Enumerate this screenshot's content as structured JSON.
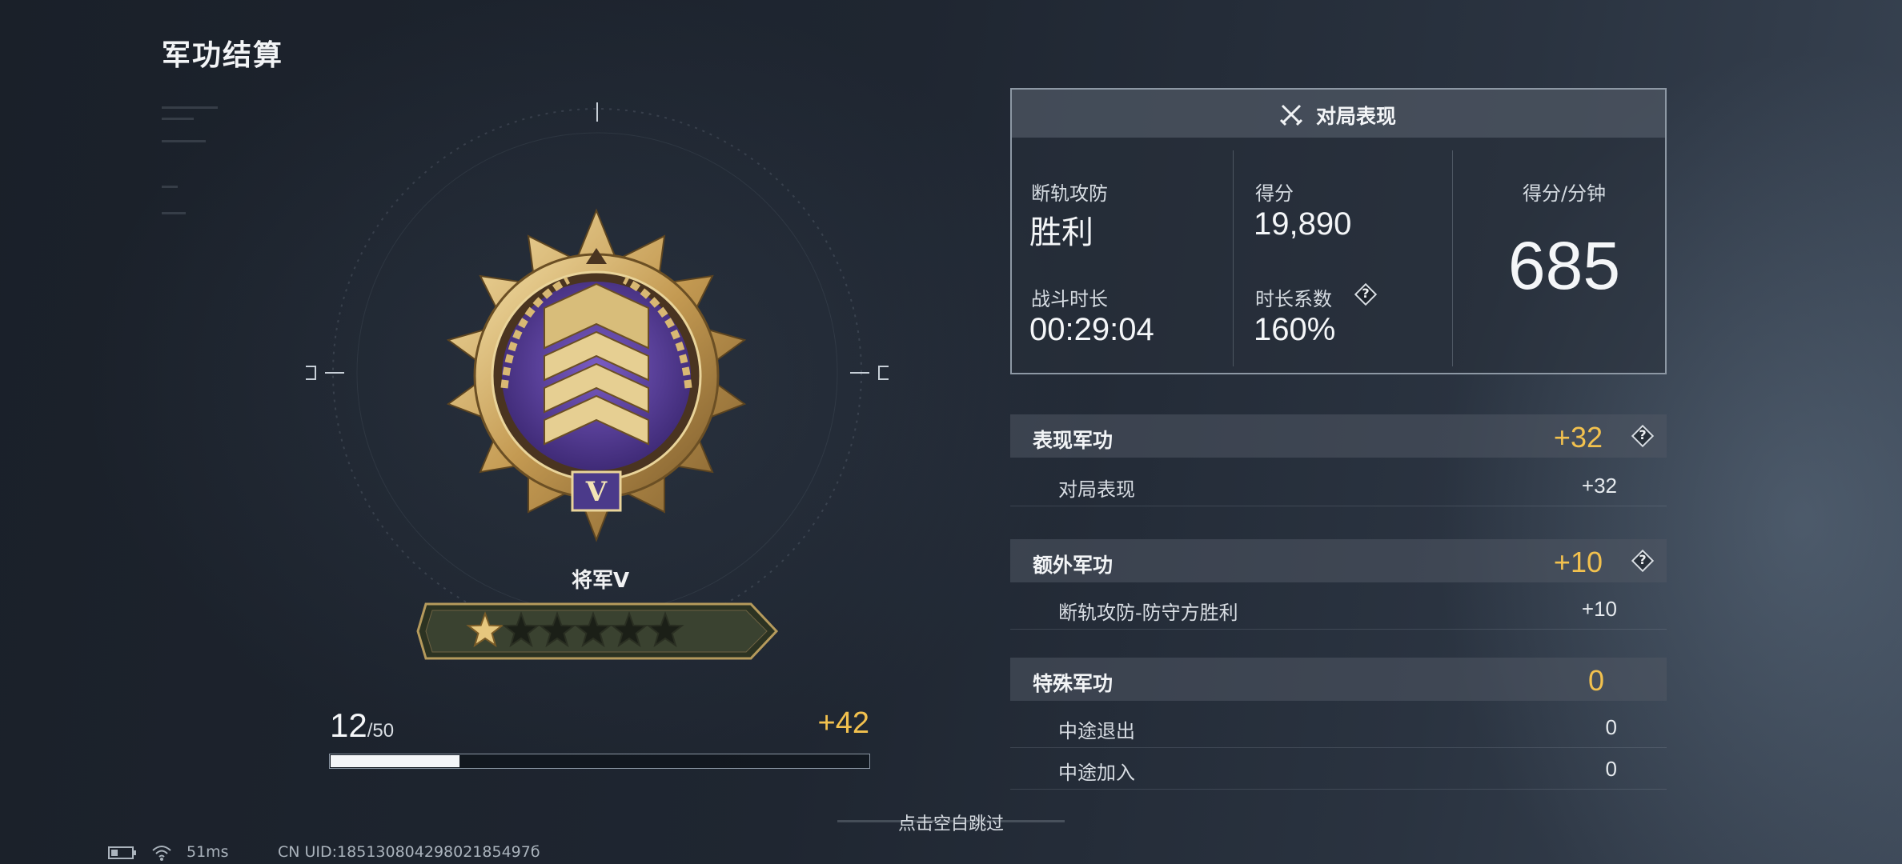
{
  "header": {
    "title": "军功结算"
  },
  "medal": {
    "rank_name": "将军V",
    "roman": "V",
    "stars_filled": 1,
    "stars_total": 6
  },
  "progress": {
    "current": "12",
    "total": "/50",
    "gain": "+42",
    "fill_fraction": 0.24
  },
  "performance": {
    "title": "对局表现",
    "mode_label": "断轨攻防",
    "result": "胜利",
    "duration_label": "战斗时长",
    "duration": "00:29:04",
    "score_label": "得分",
    "score": "19,890",
    "time_factor_label": "时长系数",
    "time_factor": "160%",
    "spm_label": "得分/分钟",
    "spm": "685",
    "help_glyph": "?"
  },
  "merits": [
    {
      "title": "表现军功",
      "value": "+32",
      "has_help": true,
      "rows": [
        {
          "label": "对局表现",
          "value": "+32"
        }
      ]
    },
    {
      "title": "额外军功",
      "value": "+10",
      "has_help": true,
      "rows": [
        {
          "label": "断轨攻防-防守方胜利",
          "value": "+10"
        }
      ]
    },
    {
      "title": "特殊军功",
      "value": "0",
      "has_help": false,
      "rows": [
        {
          "label": "中途退出",
          "value": "0"
        },
        {
          "label": "中途加入",
          "value": "0"
        }
      ]
    }
  ],
  "skip_hint": "点击空白跳过",
  "status": {
    "ping": "51ms",
    "uid": "CN UID:18513080429802185497б"
  },
  "colors": {
    "accent_gold": "#f2c14e",
    "medal_purple": "#5a3fa0",
    "gold": "#c9a45a"
  },
  "icons": [
    "swords-icon",
    "help-icon",
    "star-icon",
    "battery-icon",
    "wifi-icon"
  ]
}
